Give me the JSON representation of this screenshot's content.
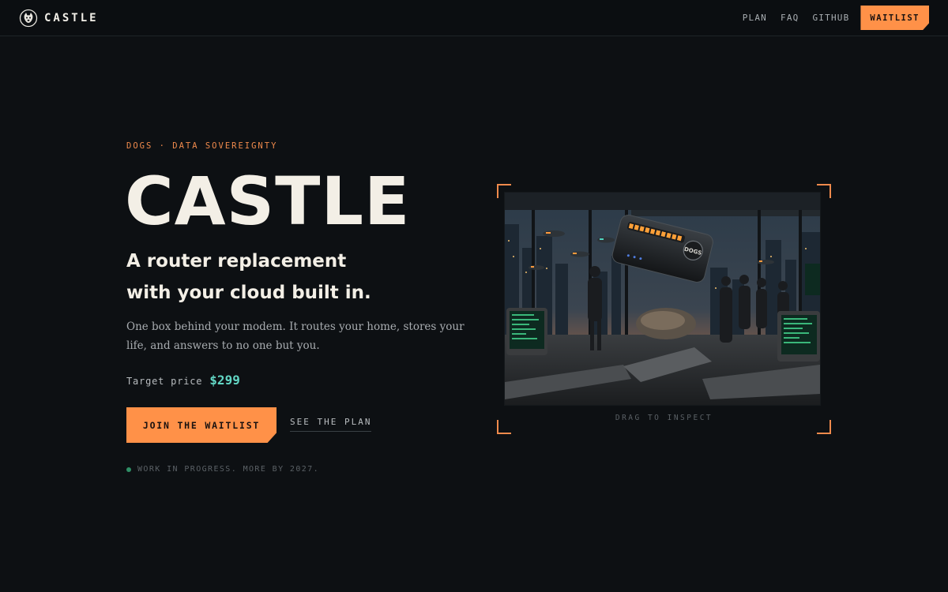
{
  "nav": {
    "brand": "CASTLE",
    "links": [
      "PLAN",
      "FAQ",
      "GITHUB"
    ],
    "cta": "WAITLIST"
  },
  "hero": {
    "eyebrow": "DOGS · DATA SOVEREIGNTY",
    "title": "CASTLE",
    "subtitle_line1": "A router replacement",
    "subtitle_line2": "with your cloud built in.",
    "description": "One box behind your modem. It routes your home, stores your life, and answers to no one but you.",
    "price_label": "Target price",
    "price_value": "$299",
    "primary_button": "JOIN THE WAITLIST",
    "secondary_button": "SEE THE PLAN",
    "status": "WORK IN PROGRESS. MORE BY 2027."
  },
  "visual": {
    "caption": "DRAG TO INSPECT",
    "device_badge": "DOGS"
  },
  "colors": {
    "background": "#0d1013",
    "accent": "#ff9148",
    "price": "#62d6c4",
    "status_dot": "#2f8f66",
    "text": "#f3efe6",
    "muted": "#a8acb0"
  },
  "icons": {
    "brand": "dog-head-icon",
    "status": "status-dot-icon"
  }
}
